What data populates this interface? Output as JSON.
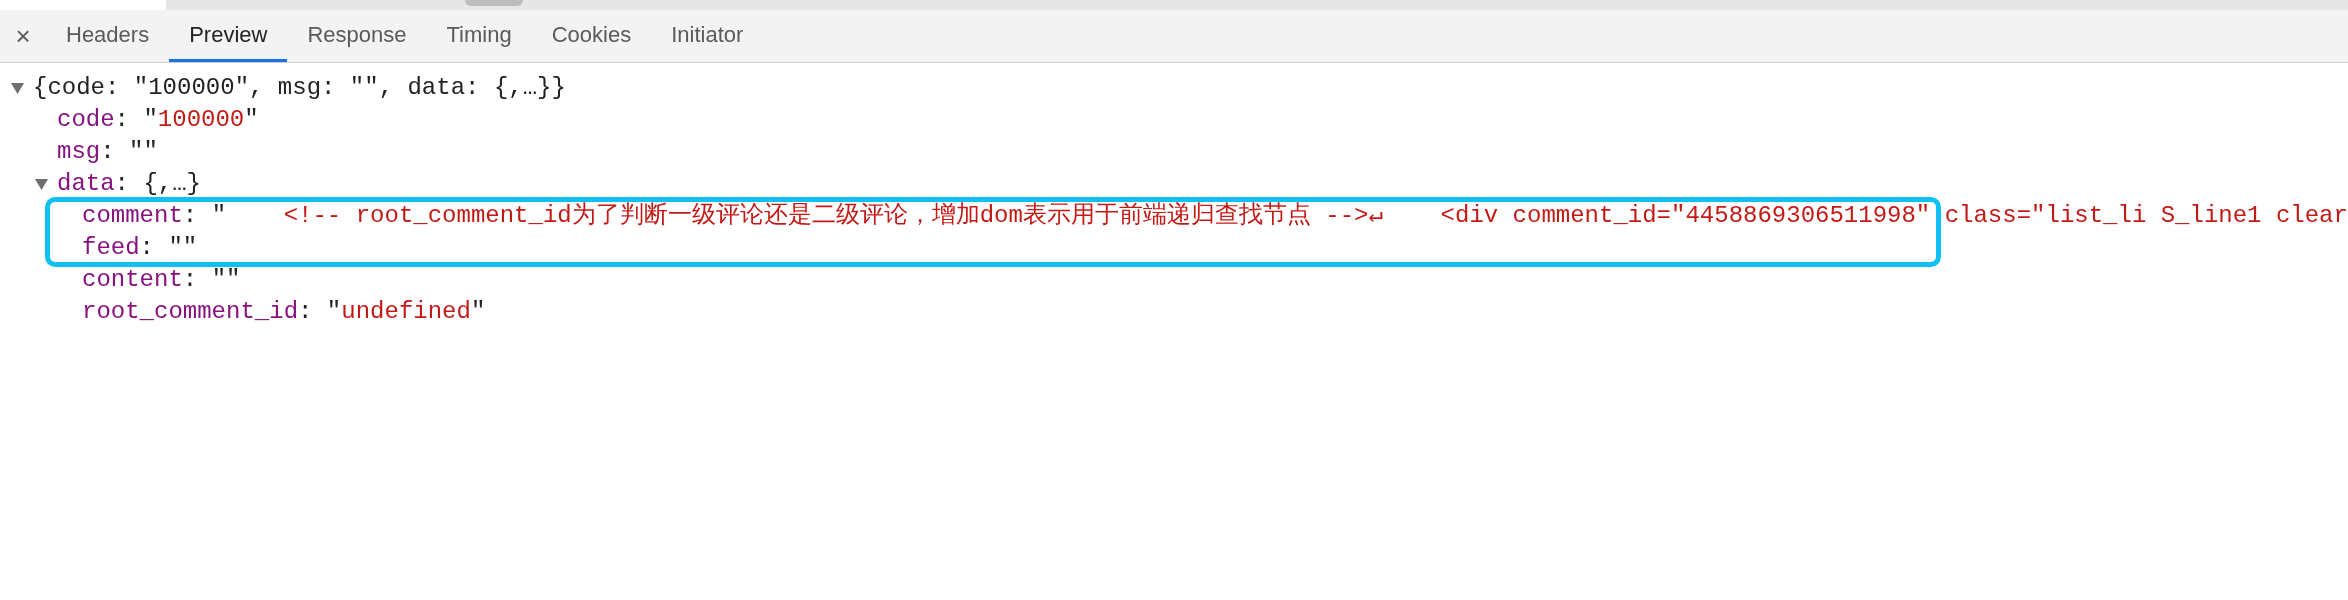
{
  "close_label": "×",
  "tabs": [
    {
      "label": "Headers",
      "selected": false
    },
    {
      "label": "Preview",
      "selected": true
    },
    {
      "label": "Response",
      "selected": false
    },
    {
      "label": "Timing",
      "selected": false
    },
    {
      "label": "Cookies",
      "selected": false
    },
    {
      "label": "Initiator",
      "selected": false
    }
  ],
  "highlight_box": true,
  "tree": {
    "expanded": true,
    "tokens": [
      {
        "kind": "punct",
        "text": "{code: \"100000\", msg: \"\", data: {,…}}"
      }
    ],
    "children": [
      {
        "tokens": [
          {
            "kind": "key",
            "text": "code"
          },
          {
            "kind": "punct",
            "text": ": \""
          },
          {
            "kind": "string",
            "text": "100000"
          },
          {
            "kind": "punct",
            "text": "\""
          }
        ]
      },
      {
        "tokens": [
          {
            "kind": "key",
            "text": "msg"
          },
          {
            "kind": "punct",
            "text": ": \"\""
          }
        ]
      },
      {
        "expanded": true,
        "tokens": [
          {
            "kind": "key",
            "text": "data"
          },
          {
            "kind": "punct",
            "text": ": {,…}"
          }
        ],
        "children": [
          {
            "tokens": [
              {
                "kind": "key",
                "text": "comment"
              },
              {
                "kind": "punct",
                "text": ": \""
              },
              {
                "kind": "string",
                "text": "    <!-- root_comment_id为了判断一级评论还是二级评论，增加dom表示用于前端递归查找节点 -->↵    <div comment_id=\"4458869306511998\" class=\"list_li S_line1 clear"
              }
            ]
          },
          {
            "tokens": [
              {
                "kind": "key",
                "text": "feed"
              },
              {
                "kind": "punct",
                "text": ": \"\""
              }
            ]
          },
          {
            "tokens": [
              {
                "kind": "key",
                "text": "content"
              },
              {
                "kind": "punct",
                "text": ": \"\""
              }
            ]
          },
          {
            "tokens": [
              {
                "kind": "key",
                "text": "root_comment_id"
              },
              {
                "kind": "punct",
                "text": ": \""
              },
              {
                "kind": "string",
                "text": "undefined"
              },
              {
                "kind": "punct",
                "text": "\""
              }
            ]
          }
        ]
      }
    ]
  }
}
